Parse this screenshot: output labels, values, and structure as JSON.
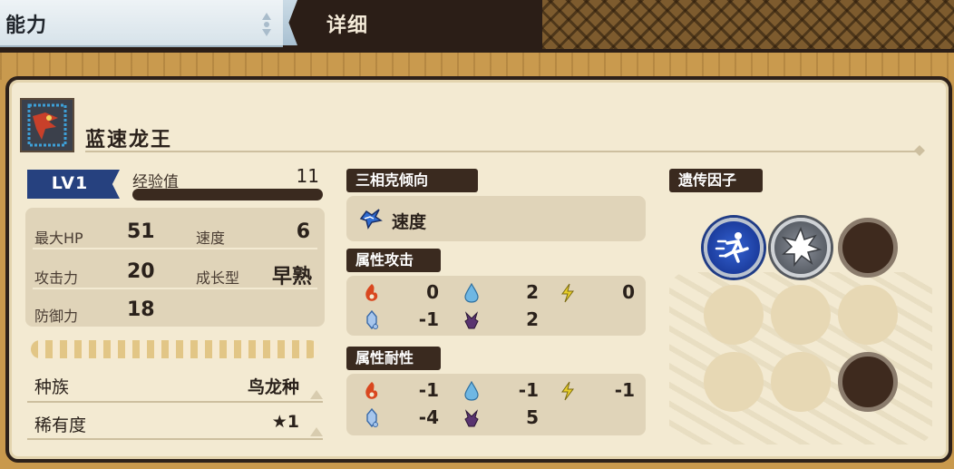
{
  "tabs": {
    "ability": "能力",
    "detail": "详细"
  },
  "monster": {
    "name": "蓝速龙王",
    "level": "LV1",
    "exp_label": "经验值",
    "exp_value": "11"
  },
  "stats": {
    "max_hp_label": "最大HP",
    "max_hp": "51",
    "speed_label": "速度",
    "speed": "6",
    "attack_label": "攻击力",
    "attack": "20",
    "growth_label": "成长型",
    "growth": "早熟",
    "defense_label": "防御力",
    "defense": "18"
  },
  "info": {
    "species_label": "种族",
    "species": "鸟龙种",
    "rarity_label": "稀有度",
    "rarity": "★1"
  },
  "rps": {
    "header": "三相克倾向",
    "value": "速度"
  },
  "element_attack": {
    "header": "属性攻击",
    "fire": "0",
    "water": "2",
    "thunder": "0",
    "ice": "-1",
    "dragon": "2"
  },
  "element_resist": {
    "header": "属性耐性",
    "fire": "-1",
    "water": "-1",
    "thunder": "-1",
    "ice": "-4",
    "dragon": "5"
  },
  "genes": {
    "header": "遗传因子",
    "slots": [
      "speed-gene",
      "power-gene",
      "empty-dark",
      "empty",
      "empty",
      "empty",
      "empty",
      "empty",
      "empty-dark"
    ]
  },
  "colors": {
    "fire": "#d9471f",
    "water": "#4fa3d8",
    "thunder": "#e0c21c",
    "ice": "#7aa6d9",
    "dragon": "#5a3470",
    "level_badge": "#26417f"
  }
}
